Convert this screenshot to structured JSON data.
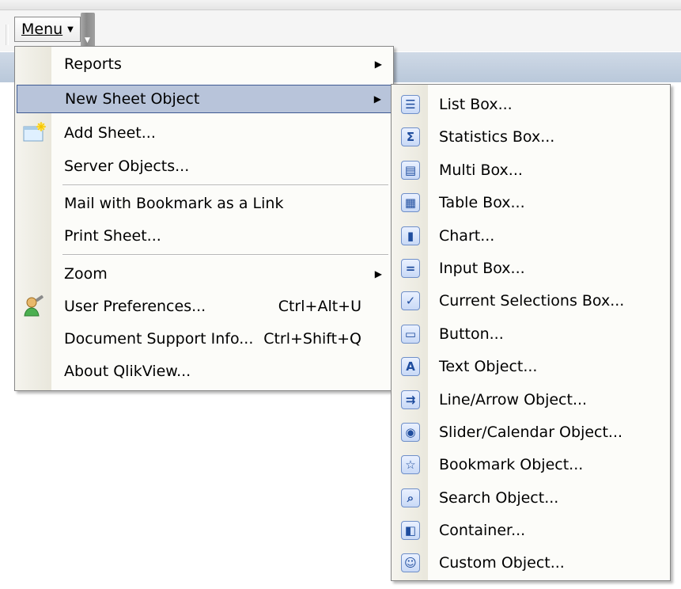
{
  "toolbar": {
    "menu_label": "Menu"
  },
  "main_menu": {
    "items": [
      {
        "label": "Reports",
        "has_submenu": true
      },
      {
        "label": "New Sheet Object",
        "has_submenu": true,
        "selected": true
      },
      {
        "label": "Add Sheet...",
        "icon": "add-sheet-icon"
      },
      {
        "label": "Server Objects..."
      },
      {
        "label": "Mail with Bookmark as a Link"
      },
      {
        "label": "Print Sheet..."
      },
      {
        "label": "Zoom",
        "has_submenu": true
      },
      {
        "label": "User Preferences...",
        "shortcut": "Ctrl+Alt+U",
        "icon": "user-preferences-icon"
      },
      {
        "label": "Document Support Info...",
        "shortcut": "Ctrl+Shift+Q"
      },
      {
        "label": "About QlikView..."
      }
    ]
  },
  "sub_menu": {
    "items": [
      {
        "label": "List Box...",
        "icon": "list-box-icon"
      },
      {
        "label": "Statistics Box...",
        "icon": "statistics-box-icon"
      },
      {
        "label": "Multi Box...",
        "icon": "multi-box-icon"
      },
      {
        "label": "Table Box...",
        "icon": "table-box-icon"
      },
      {
        "label": "Chart...",
        "icon": "chart-icon"
      },
      {
        "label": "Input Box...",
        "icon": "input-box-icon"
      },
      {
        "label": "Current Selections Box...",
        "icon": "current-selections-icon"
      },
      {
        "label": "Button...",
        "icon": "button-icon"
      },
      {
        "label": "Text Object...",
        "icon": "text-object-icon"
      },
      {
        "label": "Line/Arrow Object...",
        "icon": "line-arrow-icon"
      },
      {
        "label": "Slider/Calendar Object...",
        "icon": "slider-calendar-icon"
      },
      {
        "label": "Bookmark Object...",
        "icon": "bookmark-object-icon"
      },
      {
        "label": "Search Object...",
        "icon": "search-object-icon"
      },
      {
        "label": "Container...",
        "icon": "container-icon"
      },
      {
        "label": "Custom Object...",
        "icon": "custom-object-icon"
      }
    ]
  },
  "colors": {
    "selection_fill": "#b8c4da",
    "selection_border": "#3f5a92",
    "menu_background": "#fcfcf9",
    "icon_blue": "#1f4d9e"
  }
}
